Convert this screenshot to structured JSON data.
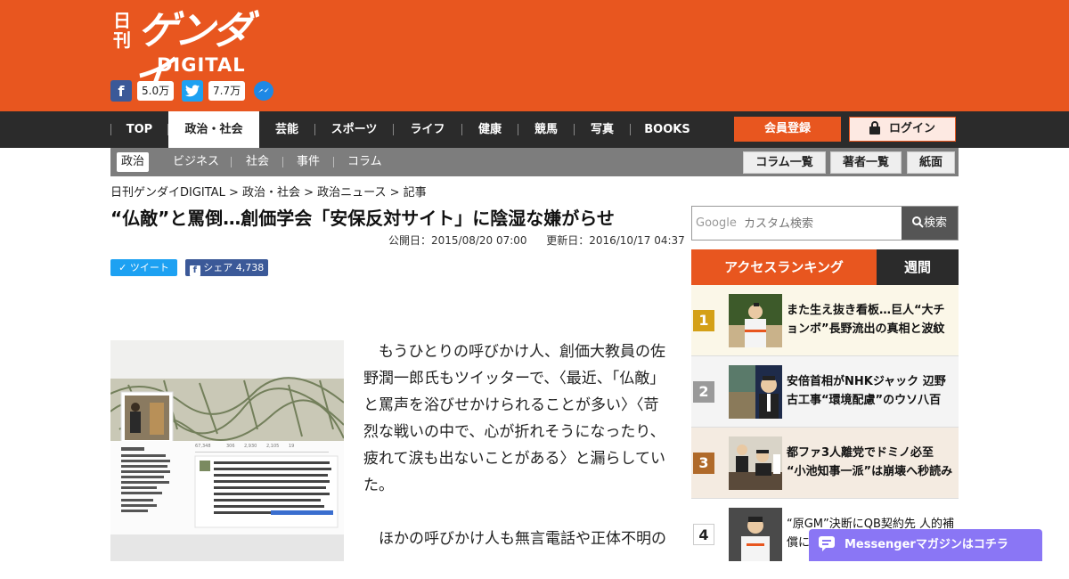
{
  "logo": {
    "nikkan": "日刊",
    "gendai": "ゲンダイ",
    "digital": "DIGITAL"
  },
  "social": {
    "facebook_count": "5.0万",
    "twitter_count": "7.7万"
  },
  "nav": {
    "items": [
      "TOP",
      "政治・社会",
      "芸能",
      "スポーツ",
      "ライフ",
      "健康",
      "競馬",
      "写真",
      "BOOKS"
    ],
    "active": "政治・社会",
    "member_button": "会員登録",
    "login_button": "ログイン"
  },
  "subnav": {
    "items": [
      "政治",
      "ビジネス",
      "社会",
      "事件",
      "コラム"
    ],
    "active": "政治",
    "buttons": [
      "コラム一覧",
      "著者一覧",
      "紙面"
    ]
  },
  "breadcrumb": "日刊ゲンダイDIGITAL > 政治・社会 > 政治ニュース > 記事",
  "article": {
    "title": "“仏敵”と罵倒…創価学会「安保反対サイト」に陰湿な嫌がらせ",
    "published": "公開日：2015/08/20 07:00",
    "updated": "更新日：2016/10/17 04:37",
    "tweet_label": "ツイート",
    "share_label": "シェア 4,738",
    "paragraphs": [
      "もうひとりの呼びかけ人、創価大教員の佐野潤一郎氏もツイッターで、〈最近、「仏敵」と罵声を浴びせかけられることが多い〉〈苛烈な戦いの中で、心が折れそうになったり、疲れて涙も出ないことがある〉と漏らしていた。",
      "ほかの呼びかけ人も無言電話や正体不明の"
    ]
  },
  "search": {
    "google_label": "Google",
    "placeholder": "カスタム検索",
    "button": "検索"
  },
  "ranking": {
    "tab_access": "アクセスランキング",
    "tab_weekly": "週間",
    "items": [
      {
        "rank": "1",
        "text": "また生え抜き看板…巨人“大チョンボ”長野流出の真相と波紋",
        "color": "#d4a017",
        "bg": "#fbf7e8"
      },
      {
        "rank": "2",
        "text": "安倍首相がNHKジャック 辺野古工事“環境配慮”のウソ八百",
        "color": "#9a9a9a",
        "bg": "#f4f4f4"
      },
      {
        "rank": "3",
        "text": "都ファ3人離党でドミノ必至 “小池知事一派”は崩壊へ秒読み",
        "color": "#b06a2a",
        "bg": "#f4ebe1"
      },
      {
        "rank": "4",
        "text": "“原GM”決断にQB契約先 人的補償に",
        "color": "#555555",
        "bg": "#ffffff"
      }
    ]
  },
  "messenger_banner": "Messengerマガジンはコチラ",
  "colors": {
    "brand": "#e8561f",
    "nav_bg": "#2b2b2b",
    "subnav_bg": "#7d7d7d",
    "messenger": "#8a76f5"
  }
}
